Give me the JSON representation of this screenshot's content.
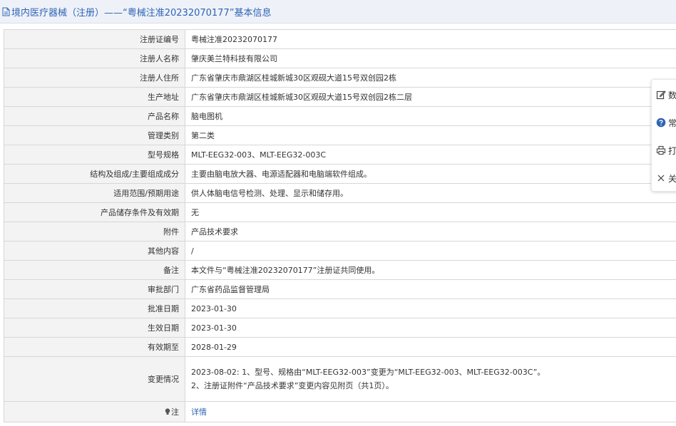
{
  "header": {
    "title": "境内医疗器械（注册）——“粤械注准20232070177”基本信息"
  },
  "rows": [
    {
      "label": "注册证编号",
      "value": "粤械注准20232070177"
    },
    {
      "label": "注册人名称",
      "value": "肇庆美兰特科技有限公司"
    },
    {
      "label": "注册人住所",
      "value": "广东省肇庆市鼎湖区桂城新城30区观砚大道15号双创园2栋"
    },
    {
      "label": "生产地址",
      "value": "广东省肇庆市鼎湖区桂城新城30区观砚大道15号双创园2栋二层"
    },
    {
      "label": "产品名称",
      "value": "脑电图机"
    },
    {
      "label": "管理类别",
      "value": "第二类"
    },
    {
      "label": "型号规格",
      "value": "MLT-EEG32-003、MLT-EEG32-003C"
    },
    {
      "label": "结构及组成/主要组成成分",
      "value": "主要由脑电放大器、电源适配器和电脑端软件组成。"
    },
    {
      "label": "适用范围/预期用途",
      "value": "供人体脑电信号检测、处理、显示和储存用。"
    },
    {
      "label": "产品储存条件及有效期",
      "value": "无"
    },
    {
      "label": "附件",
      "value": "产品技术要求"
    },
    {
      "label": "其他内容",
      "value": "/"
    },
    {
      "label": "备注",
      "value": "本文件与“粤械注准20232070177”注册证共同使用。"
    },
    {
      "label": "审批部门",
      "value": "广东省药品监督管理局"
    },
    {
      "label": "批准日期",
      "value": "2023-01-30"
    },
    {
      "label": "生效日期",
      "value": "2023-01-30"
    },
    {
      "label": "有效期至",
      "value": "2028-01-29"
    }
  ],
  "change": {
    "label": "变更情况",
    "line1": "2023-08-02: 1、型号、规格由“MLT-EEG32-003”变更为“MLT-EEG32-003、MLT-EEG32-003C”。",
    "line2": "2、注册证附件“产品技术要求”变更内容见附页（共1页）。"
  },
  "note": {
    "label": "注",
    "link": "详情"
  },
  "sidebar": {
    "items": [
      {
        "label": "数",
        "icon": "edit-icon"
      },
      {
        "label": "常",
        "icon": "help-icon"
      },
      {
        "label": "打",
        "icon": "print-icon"
      },
      {
        "label": "关",
        "icon": "close-icon"
      }
    ]
  },
  "colors": {
    "accent": "#2f63b5",
    "label_bg": "#f3f3f3",
    "border": "#d7d7d7"
  }
}
